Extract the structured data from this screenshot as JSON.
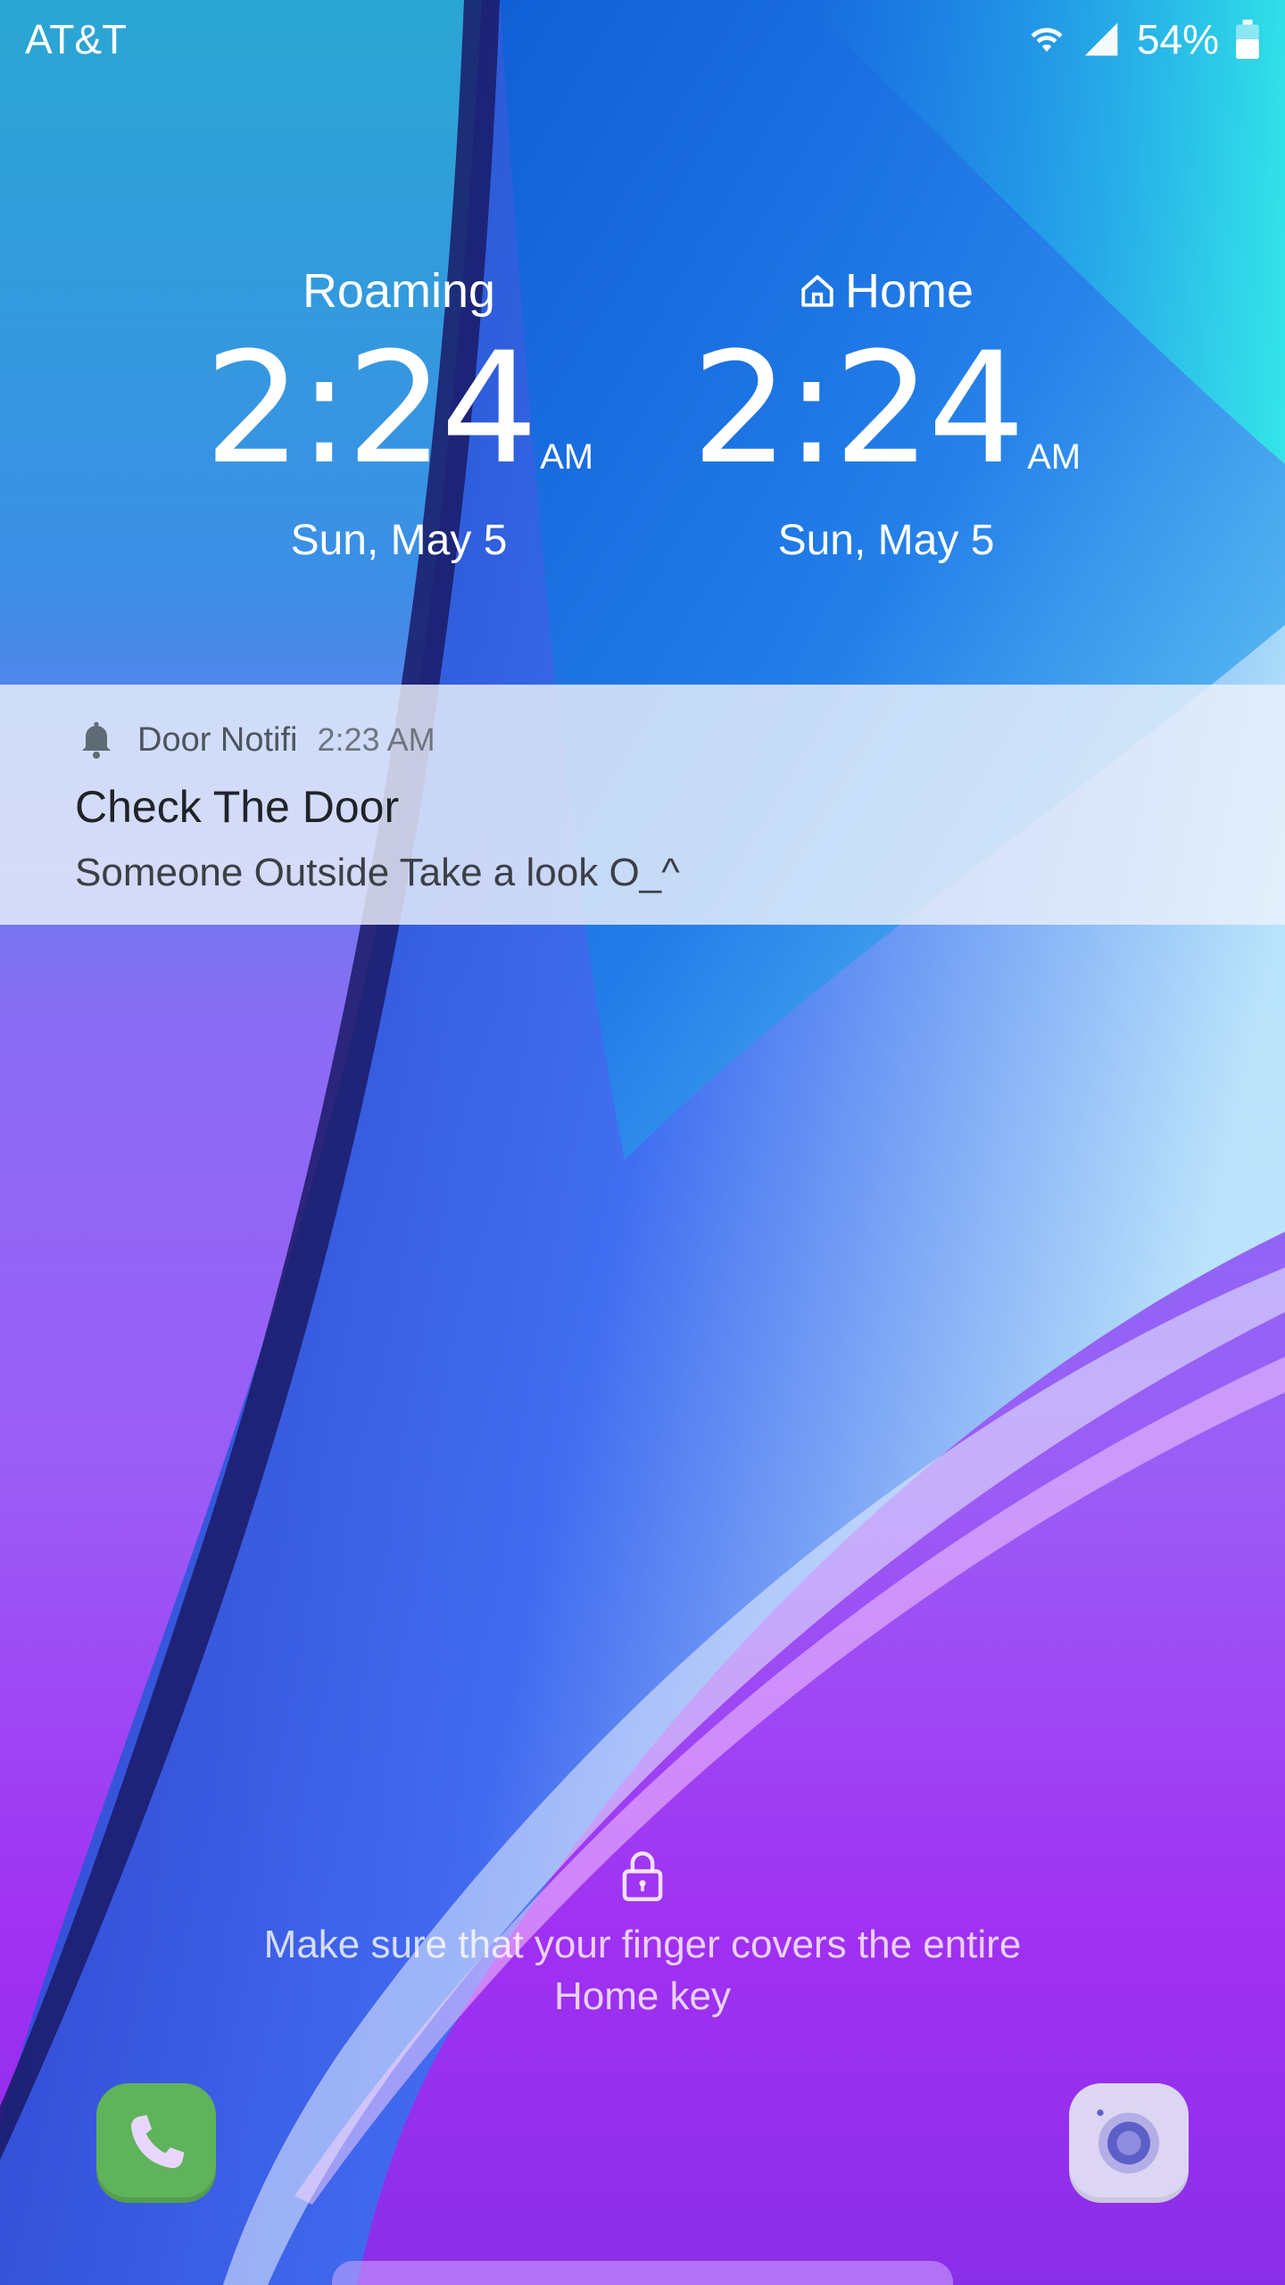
{
  "status_bar": {
    "carrier": "AT&T",
    "battery": "54%",
    "icons": [
      "wifi-icon",
      "signal-icon",
      "battery-icon"
    ]
  },
  "clocks": [
    {
      "label": "Roaming",
      "time": "2:24",
      "ampm": "AM",
      "date": "Sun, May 5",
      "icon": null
    },
    {
      "label": "Home",
      "time": "2:24",
      "ampm": "AM",
      "date": "Sun, May 5",
      "icon": "home-icon"
    }
  ],
  "notification": {
    "app_name": "Door Notifi",
    "time": "2:23 AM",
    "title": "Check The Door",
    "body": "Someone Outside Take a look O_^",
    "icon": "bell-icon"
  },
  "lock": {
    "hint_line1": "Make sure that your finger covers the entire",
    "hint_line2": "Home key"
  },
  "shortcuts": {
    "left": "phone-icon",
    "right": "camera-icon"
  },
  "colors": {
    "phone_bg": "#5fb35a",
    "camera_bg": "#dcd6f3"
  }
}
